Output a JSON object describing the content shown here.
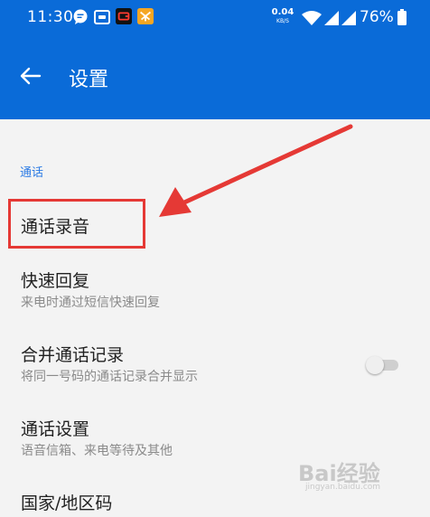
{
  "theme": {
    "primary": "#0a6bd8",
    "annotation": "#e53935",
    "section_color": "#2c7be5"
  },
  "status_bar": {
    "time": "11:30",
    "net_speed_value": "0.04",
    "net_speed_unit": "KB/S",
    "battery_percent": "76%",
    "icons": [
      "chat-bubble-icon",
      "message-icon",
      "wallet-icon",
      "app-icon",
      "wifi-icon",
      "signal-icon",
      "signal-icon",
      "battery-icon"
    ]
  },
  "header": {
    "title": "设置",
    "back_icon": "arrow-left-icon"
  },
  "section": {
    "label": "通话"
  },
  "items": [
    {
      "title": "通话录音"
    },
    {
      "title": "快速回复",
      "subtitle": "来电时通过短信快速回复"
    },
    {
      "title": "合并通话记录",
      "subtitle": "将同一号码的通话记录合并显示",
      "toggle_on": false
    },
    {
      "title": "通话设置",
      "subtitle": "语音信箱、来电等待及其他"
    },
    {
      "title": "国家/地区码"
    }
  ],
  "watermark": {
    "text": "Bai经验",
    "sub": "jingyan.baidu.com"
  }
}
